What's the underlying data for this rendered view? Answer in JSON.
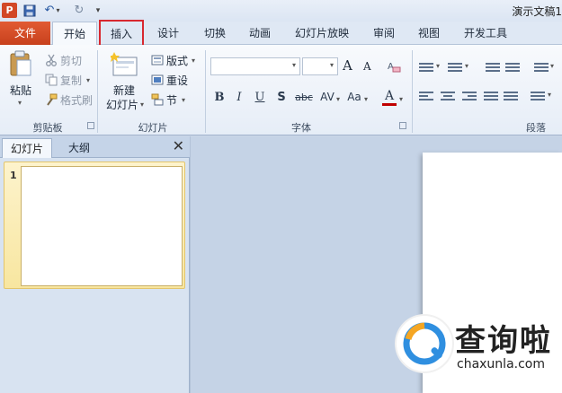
{
  "title_bar": {
    "app_icon_letter": "P",
    "document_title": "演示文稿1"
  },
  "tabs": {
    "file": "文件",
    "home": "开始",
    "insert": "插入",
    "design": "设计",
    "transitions": "切换",
    "animations": "动画",
    "slideshow": "幻灯片放映",
    "review": "审阅",
    "view": "视图",
    "developer": "开发工具"
  },
  "ribbon": {
    "clipboard": {
      "paste": "粘贴",
      "cut": "剪切",
      "copy": "复制",
      "format_painter": "格式刷",
      "group_label": "剪贴板"
    },
    "slides": {
      "new_slide_line1": "新建",
      "new_slide_line2": "幻灯片",
      "layout": "版式",
      "reset": "重设",
      "section": "节",
      "group_label": "幻灯片"
    },
    "font": {
      "font_name": "",
      "font_size": "",
      "grow": "A",
      "shrink": "A",
      "bold": "B",
      "italic": "I",
      "underline": "U",
      "shadow": "S",
      "strike": "abc",
      "spacing": "AV",
      "case": "Aa",
      "color": "A",
      "group_label": "字体"
    },
    "paragraph": {
      "group_label": "段落"
    }
  },
  "left_panel": {
    "tab_slides": "幻灯片",
    "tab_outline": "大纲",
    "close_glyph": "✕",
    "slides": [
      {
        "number": "1"
      }
    ]
  },
  "watermark": {
    "text": "查询啦",
    "url": "chaxunla.com"
  },
  "colors": {
    "file_tab": "#d24726",
    "highlight_box": "#d8282f",
    "selected_slide": "#f8e6a0",
    "ribbon_bg": "#eef3fa"
  }
}
